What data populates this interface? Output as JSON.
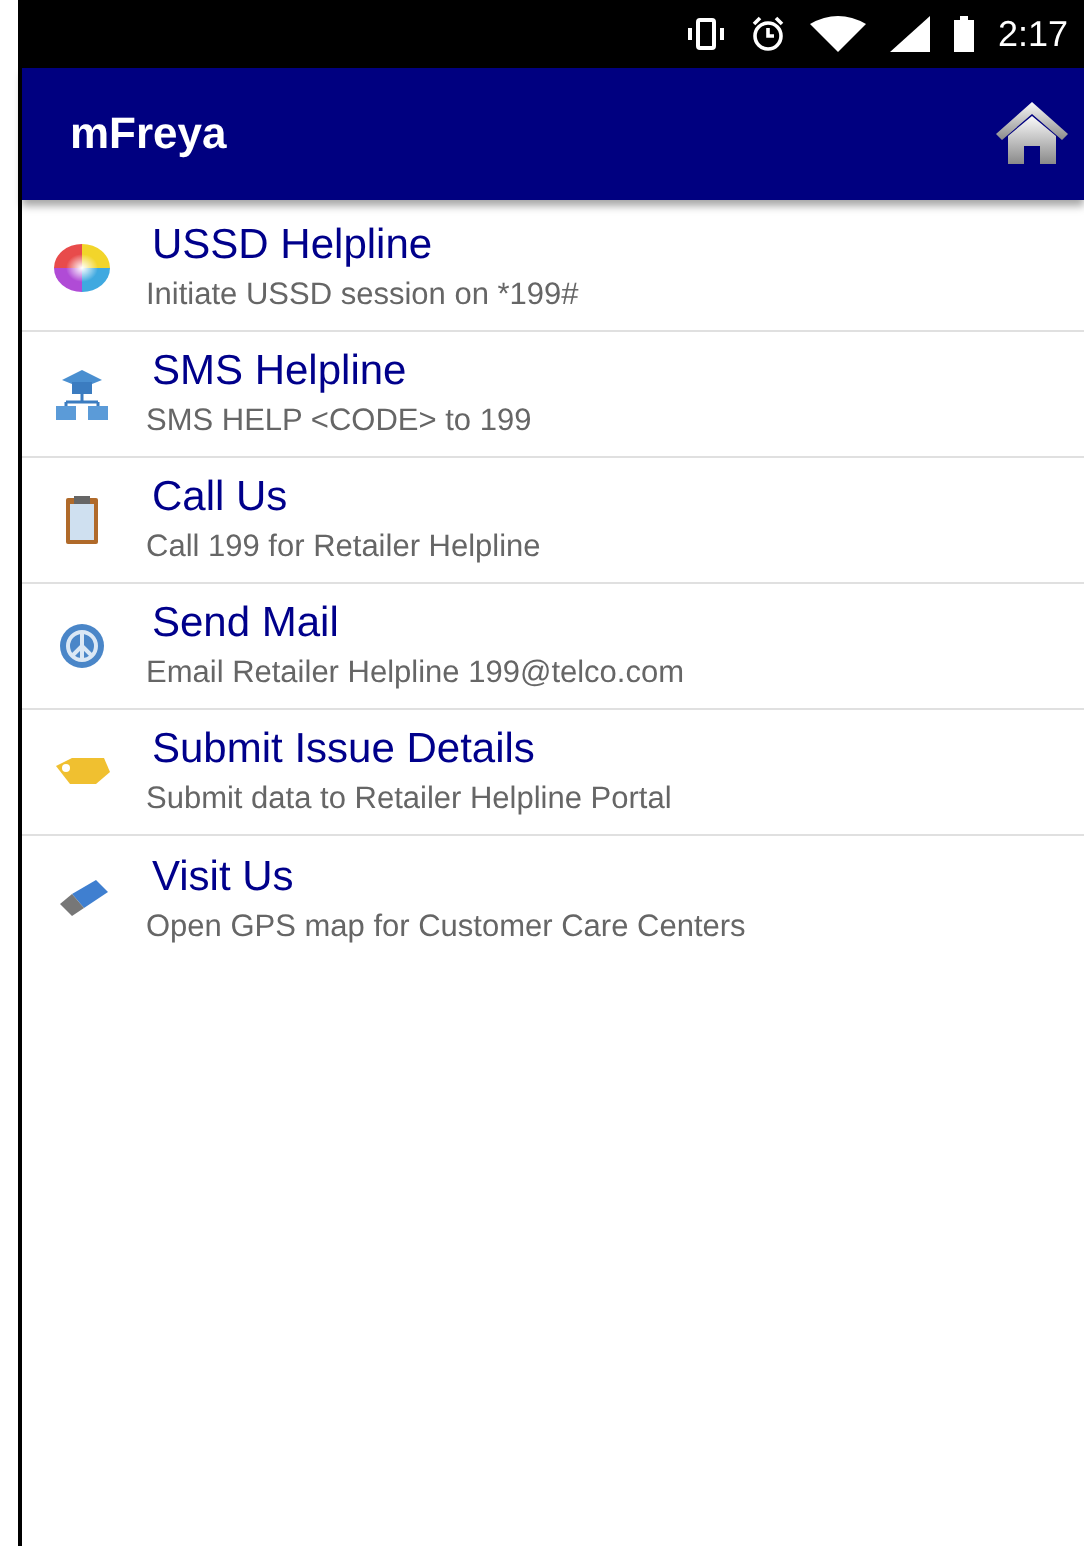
{
  "status_bar": {
    "time": "2:17"
  },
  "app_bar": {
    "title": "mFreya"
  },
  "items": [
    {
      "kind": "color-wheel",
      "title": "USSD Helpline",
      "subtitle": "Initiate USSD session on *199#"
    },
    {
      "kind": "hierarchy",
      "title": "SMS Helpline",
      "subtitle": "SMS HELP <CODE> to 199"
    },
    {
      "kind": "clipboard",
      "title": "Call Us",
      "subtitle": "Call 199 for Retailer Helpline"
    },
    {
      "kind": "peace",
      "title": "Send Mail",
      "subtitle": "Email Retailer Helpline 199@telco.com"
    },
    {
      "kind": "tag",
      "title": "Submit Issue Details",
      "subtitle": "Submit data to Retailer Helpline Portal"
    },
    {
      "kind": "usb",
      "title": "Visit Us",
      "subtitle": "Open GPS map for Customer Care Centers"
    }
  ]
}
